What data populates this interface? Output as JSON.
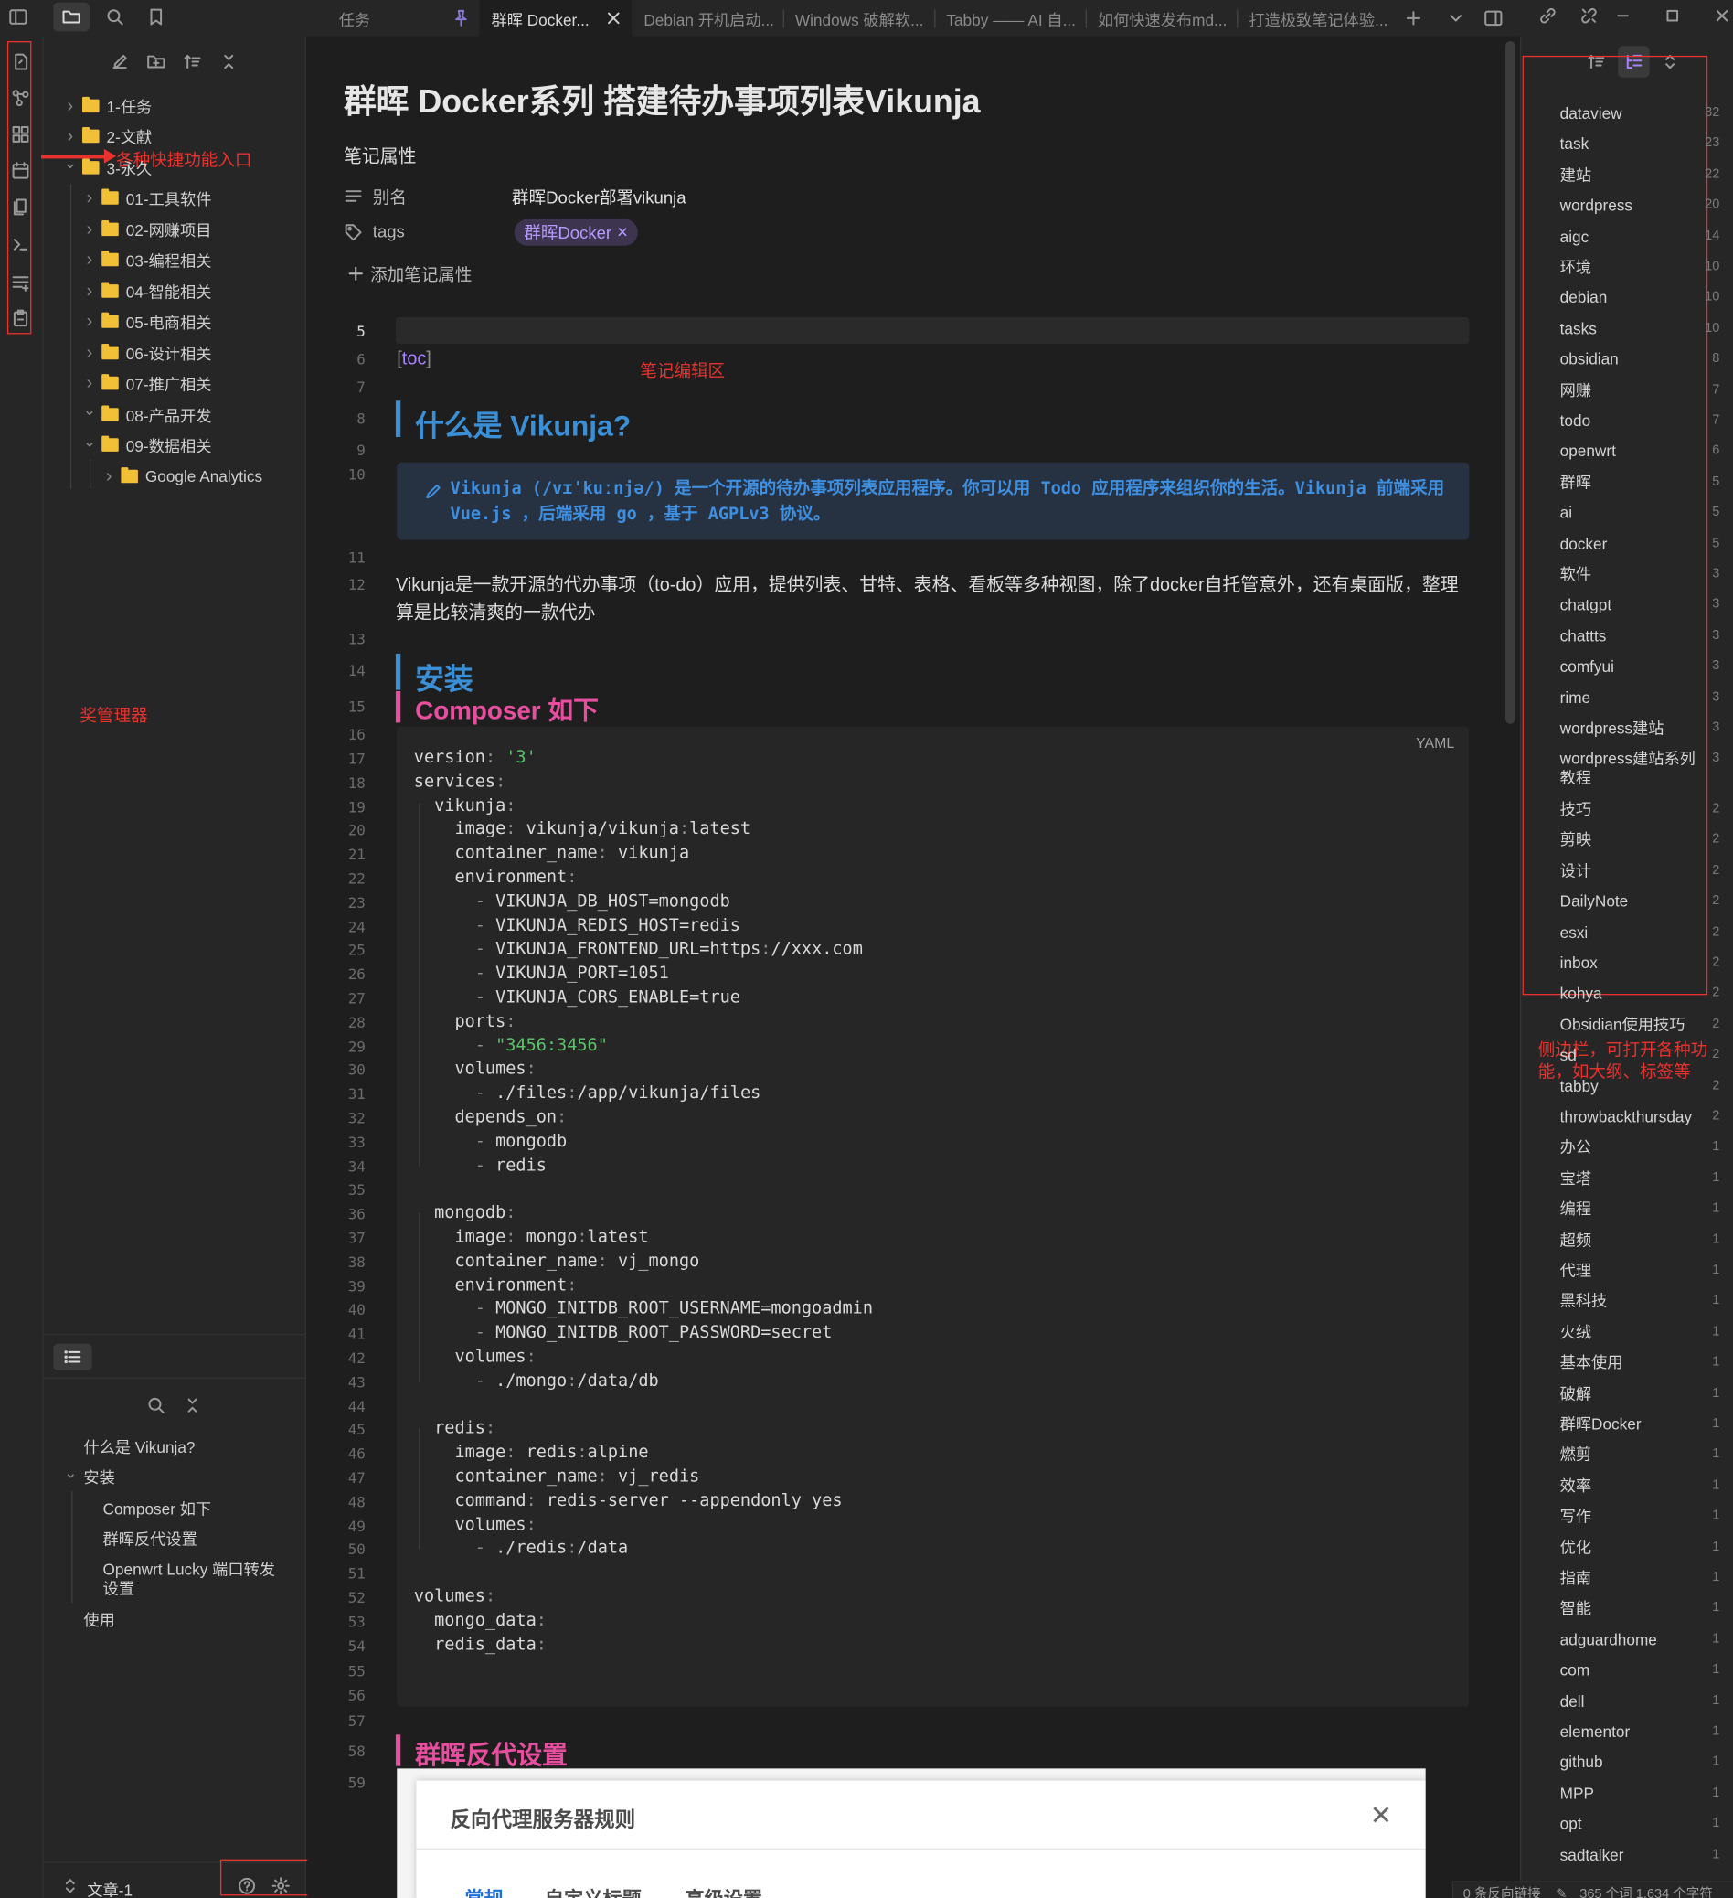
{
  "tabs": [
    {
      "label": "任务",
      "pinned": true
    },
    {
      "label": "群晖 Docker...",
      "active": true
    },
    {
      "label": "Debian 开机启动..."
    },
    {
      "label": "Windows 破解软..."
    },
    {
      "label": "Tabby —— AI 自..."
    },
    {
      "label": "如何快速发布md..."
    },
    {
      "label": "打造极致笔记体验..."
    }
  ],
  "explorer": {
    "items": [
      {
        "label": "1-任务",
        "depth": 0,
        "expanded": false
      },
      {
        "label": "2-文献",
        "depth": 0,
        "expanded": false
      },
      {
        "label": "3-永久",
        "depth": 0,
        "expanded": true
      },
      {
        "label": "01-工具软件",
        "depth": 1,
        "expanded": false
      },
      {
        "label": "02-网赚项目",
        "depth": 1,
        "expanded": false
      },
      {
        "label": "03-编程相关",
        "depth": 1,
        "expanded": false
      },
      {
        "label": "04-智能相关",
        "depth": 1,
        "expanded": false
      },
      {
        "label": "05-电商相关",
        "depth": 1,
        "expanded": false
      },
      {
        "label": "06-设计相关",
        "depth": 1,
        "expanded": false
      },
      {
        "label": "07-推广相关",
        "depth": 1,
        "expanded": false
      },
      {
        "label": "08-产品开发",
        "depth": 1,
        "expanded": true
      },
      {
        "label": "09-数据相关",
        "depth": 1,
        "expanded": true
      },
      {
        "label": "Google Analytics",
        "depth": 2,
        "expanded": false
      }
    ],
    "vault_name": "文章-1"
  },
  "outline": {
    "items": [
      {
        "label": "什么是 Vikunja?",
        "depth": 0
      },
      {
        "label": "安装",
        "depth": 0,
        "expanded": true
      },
      {
        "label": "Composer 如下",
        "depth": 1
      },
      {
        "label": "群晖反代设置",
        "depth": 1
      },
      {
        "label": "Openwrt Lucky 端口转发设置",
        "depth": 1
      },
      {
        "label": "使用",
        "depth": 0
      }
    ]
  },
  "note": {
    "title": "群晖 Docker系列 搭建待办事项列表Vikunja",
    "properties_heading": "笔记属性",
    "prop_alias_key": "别名",
    "prop_alias_value": "群晖Docker部署vikunja",
    "prop_tags_key": "tags",
    "prop_tags_value": "群晖Docker",
    "add_property": "添加笔记属性",
    "toc": "toc",
    "h2_what": "什么是 Vikunja?",
    "callout_text": "Vikunja (/vɪˈkuːnjə/) 是一个开源的待办事项列表应用程序。你可以用 Todo 应用程序来组织你的生活。Vikunja 前端采用 Vue.js ，后端采用 go ，基于 AGPLv3 协议。",
    "paragraph": "Vikunja是一款开源的代办事项（to-do）应用，提供列表、甘特、表格、看板等多种视图，除了docker自托管意外，还有桌面版，整理算是比较清爽的一款代办",
    "h2_install": "安装",
    "h3_composer": "Composer 如下",
    "code_lang": "YAML",
    "h3_proxy": "群晖反代设置",
    "dialog_title": "反向代理服务器规则",
    "dialog_tabs": [
      "常规",
      "自定义标题",
      "高级设置"
    ]
  },
  "line_numbers": [
    "5",
    "6",
    "7",
    "8",
    "9",
    "10",
    "11",
    "12",
    "13",
    "14",
    "15",
    "16",
    "17",
    "18",
    "19",
    "20",
    "21",
    "22",
    "23",
    "24",
    "25",
    "26",
    "27",
    "28",
    "29",
    "30",
    "31",
    "32",
    "33",
    "34",
    "35",
    "36",
    "37",
    "38",
    "39",
    "40",
    "41",
    "42",
    "43",
    "44",
    "45",
    "46",
    "47",
    "48",
    "49",
    "50",
    "51",
    "52",
    "53",
    "54",
    "55",
    "56",
    "57",
    "58",
    "59"
  ],
  "code_lines": [
    "version: '3'",
    "services:",
    "  vikunja:",
    "    image: vikunja/vikunja:latest",
    "    container_name: vikunja",
    "    environment:",
    "      - VIKUNJA_DB_HOST=mongodb",
    "      - VIKUNJA_REDIS_HOST=redis",
    "      - VIKUNJA_FRONTEND_URL=https://xxx.com",
    "      - VIKUNJA_PORT=1051",
    "      - VIKUNJA_CORS_ENABLE=true",
    "    ports:",
    "      - \"3456:3456\"",
    "    volumes:",
    "      - ./files:/app/vikunja/files",
    "    depends_on:",
    "      - mongodb",
    "      - redis",
    "",
    "  mongodb:",
    "    image: mongo:latest",
    "    container_name: vj_mongo",
    "    environment:",
    "      - MONGO_INITDB_ROOT_USERNAME=mongoadmin",
    "      - MONGO_INITDB_ROOT_PASSWORD=secret",
    "    volumes:",
    "      - ./mongo:/data/db",
    "",
    "  redis:",
    "    image: redis:alpine",
    "    container_name: vj_redis",
    "    command: redis-server --appendonly yes",
    "    volumes:",
    "      - ./redis:/data",
    "",
    "volumes:",
    "  mongo_data:",
    "  redis_data:"
  ],
  "tags": [
    {
      "name": "dataview",
      "count": "32"
    },
    {
      "name": "task",
      "count": "23"
    },
    {
      "name": "建站",
      "count": "22"
    },
    {
      "name": "wordpress",
      "count": "20"
    },
    {
      "name": "aigc",
      "count": "14"
    },
    {
      "name": "环境",
      "count": "10"
    },
    {
      "name": "debian",
      "count": "10"
    },
    {
      "name": "tasks",
      "count": "10"
    },
    {
      "name": "obsidian",
      "count": "8"
    },
    {
      "name": "网赚",
      "count": "7"
    },
    {
      "name": "todo",
      "count": "7"
    },
    {
      "name": "openwrt",
      "count": "6"
    },
    {
      "name": "群晖",
      "count": "5"
    },
    {
      "name": "ai",
      "count": "5"
    },
    {
      "name": "docker",
      "count": "5"
    },
    {
      "name": "软件",
      "count": "3"
    },
    {
      "name": "chatgpt",
      "count": "3"
    },
    {
      "name": "chattts",
      "count": "3"
    },
    {
      "name": "comfyui",
      "count": "3"
    },
    {
      "name": "rime",
      "count": "3"
    },
    {
      "name": "wordpress建站",
      "count": "3"
    },
    {
      "name": "wordpress建站系列教程",
      "count": "3"
    },
    {
      "name": "技巧",
      "count": "2"
    },
    {
      "name": "剪映",
      "count": "2"
    },
    {
      "name": "设计",
      "count": "2"
    },
    {
      "name": "DailyNote",
      "count": "2"
    },
    {
      "name": "esxi",
      "count": "2"
    },
    {
      "name": "inbox",
      "count": "2"
    },
    {
      "name": "kohya",
      "count": "2"
    },
    {
      "name": "Obsidian使用技巧",
      "count": "2"
    },
    {
      "name": "sd",
      "count": "2"
    },
    {
      "name": "tabby",
      "count": "2"
    },
    {
      "name": "throwbackthursday",
      "count": "2"
    },
    {
      "name": "办公",
      "count": "1"
    },
    {
      "name": "宝塔",
      "count": "1"
    },
    {
      "name": "编程",
      "count": "1"
    },
    {
      "name": "超频",
      "count": "1"
    },
    {
      "name": "代理",
      "count": "1"
    },
    {
      "name": "黑科技",
      "count": "1"
    },
    {
      "name": "火绒",
      "count": "1"
    },
    {
      "name": "基本使用",
      "count": "1"
    },
    {
      "name": "破解",
      "count": "1"
    },
    {
      "name": "群晖Docker",
      "count": "1"
    },
    {
      "name": "燃剪",
      "count": "1"
    },
    {
      "name": "效率",
      "count": "1"
    },
    {
      "name": "写作",
      "count": "1"
    },
    {
      "name": "优化",
      "count": "1"
    },
    {
      "name": "指南",
      "count": "1"
    },
    {
      "name": "智能",
      "count": "1"
    },
    {
      "name": "adguardhome",
      "count": "1"
    },
    {
      "name": "com",
      "count": "1"
    },
    {
      "name": "dell",
      "count": "1"
    },
    {
      "name": "elementor",
      "count": "1"
    },
    {
      "name": "github",
      "count": "1"
    },
    {
      "name": "MPP",
      "count": "1"
    },
    {
      "name": "opt",
      "count": "1"
    },
    {
      "name": "sadtalker",
      "count": "1"
    }
  ],
  "status_bar": {
    "backlinks": "0 条反向链接",
    "words": "365 个词  1,634 个字符"
  },
  "annotations": {
    "ribbon": "各种快捷功能入口",
    "explorer": "奖管理器",
    "editor": "笔记编辑区",
    "sidebar": "侧边栏，可打开各种功能，如大纲、标签等"
  },
  "colors": {
    "accent": "#a882ff",
    "h2": "#3a8fd6",
    "h3": "#e64e9e",
    "annotation": "#e8322e",
    "string": "#5ac46a",
    "folder": "#f2c037"
  }
}
